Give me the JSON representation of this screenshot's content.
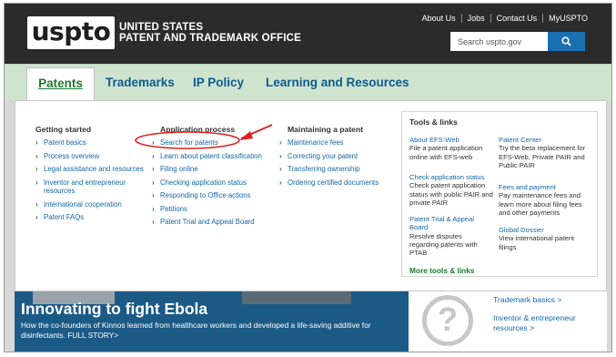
{
  "header": {
    "logo_text": "uspto",
    "org_line1": "UNITED STATES",
    "org_line2": "PATENT AND TRADEMARK OFFICE",
    "util_links": [
      "About Us",
      "Jobs",
      "Contact Us",
      "MyUSPTO"
    ],
    "search_placeholder": "Search uspto.gov",
    "search_icon": "search-icon"
  },
  "nav": {
    "tabs": [
      "Patents",
      "Trademarks",
      "IP Policy",
      "Learning and Resources"
    ]
  },
  "menu": {
    "getting_started": {
      "heading": "Getting started",
      "items": [
        "Patent basics",
        "Process overview",
        "Legal assistance and resources",
        "Inventor and entrepreneur resources",
        "International cooperation",
        "Patent FAQs"
      ]
    },
    "application_process": {
      "heading": "Application process",
      "items": [
        "Search for patents",
        "Learn about patent classification",
        "Filing online",
        "Checking application status",
        "Responding to Office actions",
        "Petitions",
        "Patent Trial and Appeal Board"
      ]
    },
    "maintaining": {
      "heading": "Maintaining a patent",
      "items": [
        "Maintenance fees",
        "Correcting your patent",
        "Transferring ownership",
        "Ordering certified documents"
      ]
    },
    "tools": {
      "heading": "Tools & links",
      "items": [
        {
          "title": "About EFS-Web",
          "desc": "File a patent application online with EFS-web"
        },
        {
          "title": "Patent Center",
          "desc": "Try the beta replacement for EFS-Web, Private PAIR and Public PAIR"
        },
        {
          "title": "Check application status",
          "desc": "Check patent application status with public PAIR and private PAIR"
        },
        {
          "title": "Fees and payment",
          "desc": "Pay maintenance fees and learn more about filing fees and other payments"
        },
        {
          "title": "Patent Trial & Appeal Board",
          "desc": "Resolve disputes regarding patents with PTAB"
        },
        {
          "title": "Global Dossier",
          "desc": "View international patent filings"
        }
      ],
      "more": "More tools & links"
    },
    "annotation_color": "#e02020"
  },
  "hero": {
    "title": "Innovating to fight Ebola",
    "subtitle": "How the co-founders of Kinnos learned from healthcare workers and developed a life-saving additive for disinfectants. FULL STORY>"
  },
  "side_links": [
    "Trademark basics >",
    "Inventor & entrepreneur resources >"
  ],
  "colors": {
    "brand_green": "#1f7a2e",
    "link_blue": "#1467a6",
    "header_dark": "#2b2b2b",
    "search_blue": "#1a6fb1"
  }
}
